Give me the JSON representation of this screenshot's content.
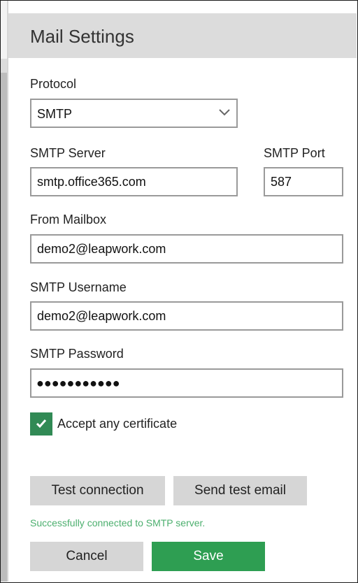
{
  "header": {
    "title": "Mail Settings"
  },
  "protocol": {
    "label": "Protocol",
    "selected": "SMTP"
  },
  "smtp_server": {
    "label": "SMTP Server",
    "value": "smtp.office365.com"
  },
  "smtp_port": {
    "label": "SMTP Port",
    "value": "587"
  },
  "from_mailbox": {
    "label": "From Mailbox",
    "value": "demo2@leapwork.com"
  },
  "smtp_username": {
    "label": "SMTP Username",
    "value": "demo2@leapwork.com"
  },
  "smtp_password": {
    "label": "SMTP Password",
    "masked": "●●●●●●●●●●●"
  },
  "accept_cert": {
    "label": "Accept any certificate",
    "checked": true
  },
  "actions": {
    "test_connection": "Test connection",
    "send_test_email": "Send test email",
    "cancel": "Cancel",
    "save": "Save"
  },
  "status": {
    "message": "Successfully connected to SMTP server."
  },
  "colors": {
    "accent": "#2e9e52",
    "status_text": "#4caf6e",
    "header_bg": "#dcdcdc",
    "button_bg": "#d6d6d6"
  }
}
